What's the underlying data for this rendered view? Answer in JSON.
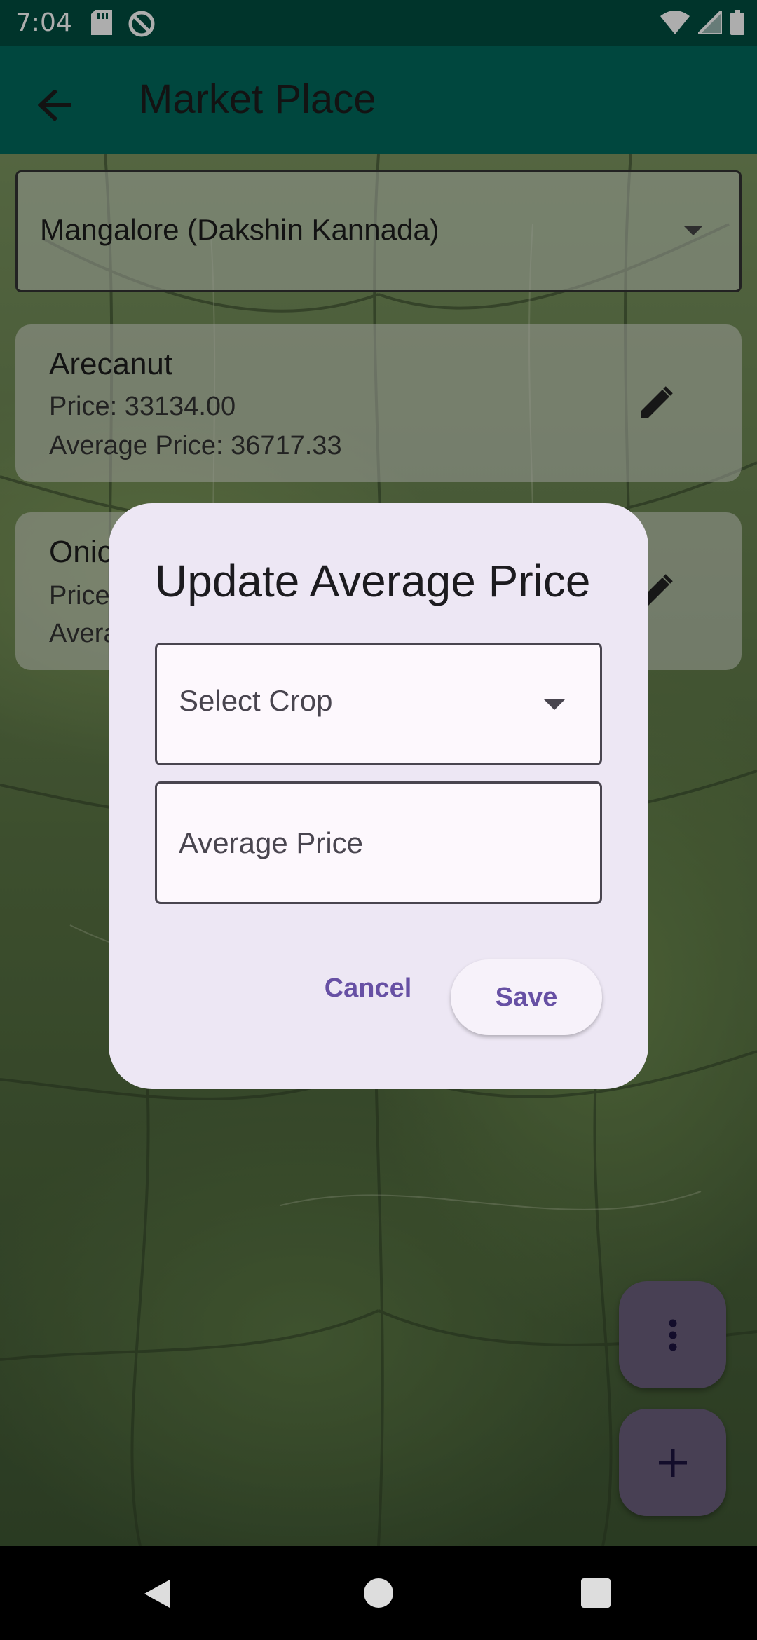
{
  "status_bar": {
    "time": "7:04",
    "icons_left": [
      "sd-card-icon",
      "at-sign-icon"
    ],
    "icons_right": [
      "wifi-icon",
      "cell-signal-icon",
      "battery-icon"
    ]
  },
  "app_bar": {
    "back_icon": "arrow-left-icon",
    "title": "Market Place"
  },
  "district_select": {
    "value": "Mangalore (Dakshin Kannada)"
  },
  "crops": [
    {
      "name": "Arecanut",
      "price_text": "Price: 33134.00",
      "average_text": "Average Price: 36717.33"
    },
    {
      "name": "Onic",
      "price_text": "Price",
      "average_text": "Avera"
    }
  ],
  "dialog": {
    "title": "Update Average Price",
    "crop_select_label": "Select Crop",
    "average_price_placeholder": "Average Price",
    "cancel_label": "Cancel",
    "save_label": "Save"
  },
  "fabs": {
    "more_icon": "more-vert-icon",
    "add_icon": "plus-icon"
  },
  "colors": {
    "status_bar": "#004d40",
    "app_bar": "#00695c",
    "dialog_bg": "#ede7f4",
    "accent": "#6750a4",
    "fab": "#6b5f7d"
  }
}
